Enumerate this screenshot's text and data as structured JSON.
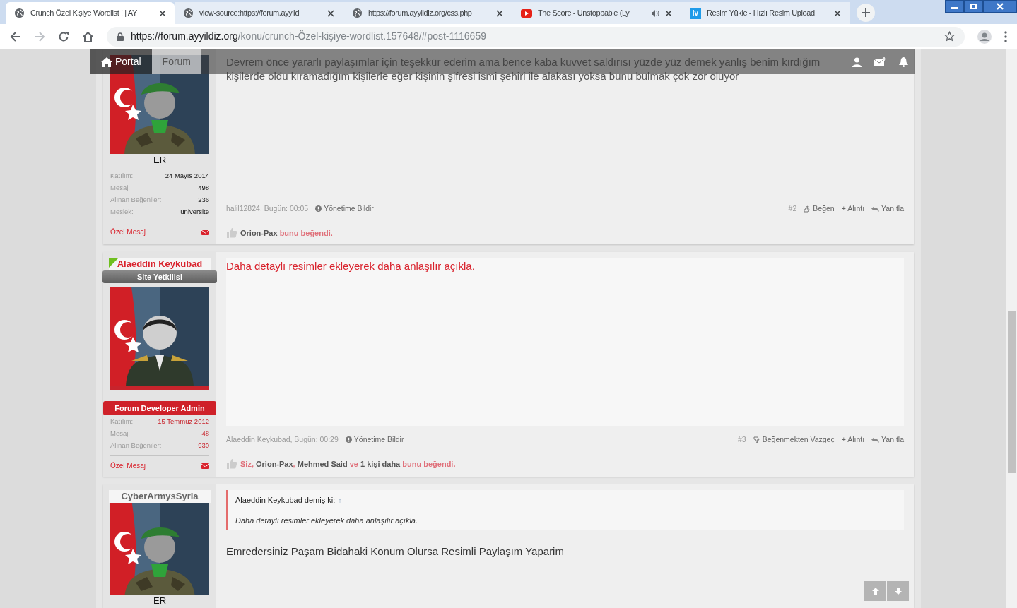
{
  "browser": {
    "tabs": [
      {
        "title": "Crunch Özel Kişiye Wordlist ! | AY",
        "kind": "globe",
        "selected": true,
        "audio": false
      },
      {
        "title": "view-source:https://forum.ayyildi",
        "kind": "globe",
        "selected": false,
        "audio": false
      },
      {
        "title": "https://forum.ayyildiz.org/css.php",
        "kind": "globe",
        "selected": false,
        "audio": false
      },
      {
        "title": "The Score - Unstoppable (Ly",
        "kind": "video",
        "selected": false,
        "audio": true
      },
      {
        "title": "Resim Yükle - Hızlı Resim Upload",
        "kind": "letters",
        "icon_text": "iv",
        "selected": false,
        "audio": false
      }
    ],
    "address": {
      "host": "https://forum.ayyildiz.org",
      "path": "/konu/crunch-Özel-kişiye-wordlist.157648/#post-1116659"
    }
  },
  "nav": {
    "items": [
      {
        "label": "Portal",
        "kind": "home",
        "selected": false
      },
      {
        "label": "Forum",
        "selected": true
      }
    ]
  },
  "posts": [
    {
      "user": {
        "staff": false,
        "title": "ER",
        "stats": [
          {
            "label": "Katılım:",
            "value": "24 Mayıs 2014"
          },
          {
            "label": "Mesaj:",
            "value": "498"
          },
          {
            "label": "Alınan Beğeniler:",
            "value": "236"
          },
          {
            "label": "Meslek:",
            "value": "üniversite"
          }
        ],
        "pm": "Özel Mesaj"
      },
      "text": "Devrem önce yararlı paylaşımlar için teşekkür ederim ama bence kaba kuvvet saldırısı yüzde yüz demek yanlış benim kırdığım kişilerde oldu kıramadığım kişilerle eğer kişinin şifresi ismi şehiri ile alakası yoksa bunu bulmak çok zor oluyor",
      "kind": "plain",
      "footer": {
        "author": "halil12824, Bugün: 00:05",
        "report": "Yönetime Bildir",
        "number": "#2",
        "liked": false,
        "like": "Beğen",
        "quote": "+ Alıntı",
        "reply": "Yanıtla"
      },
      "likes": "**Orion-Pax** bunu beğendi."
    },
    {
      "user": {
        "name": "Alaeddin Keykubad",
        "staff": true,
        "online": true,
        "banner": "Site Yetkilisi",
        "ribbon": "Forum Developer Admin",
        "stats": [
          {
            "label": "Katılım:",
            "value": "15 Temmuz 2012"
          },
          {
            "label": "Mesaj:",
            "value": "48"
          },
          {
            "label": "Alınan Beğeniler:",
            "value": "930"
          }
        ],
        "pm": "Özel Mesaj"
      },
      "text": "Daha detaylı resimler ekleyerek daha anlaşılır açıkla.",
      "kind": "highlight",
      "footer": {
        "author": "Alaeddin Keykubad, Bugün: 00:29",
        "report": "Yönetime Bildir",
        "number": "#3",
        "liked": true,
        "like": "Beğenmekten Vazgeç",
        "quote": "+ Alıntı",
        "reply": "Yanıtla"
      },
      "likes": "Siz, **Orion-Pax**, **Mehmed Said** ve **1 kişi daha** bunu beğendi."
    },
    {
      "user": {
        "name": "CyberArmysSyria",
        "staff": false,
        "online": false,
        "title": "ER"
      },
      "quote": {
        "author": "Alaeddin Keykubad demiş ki:",
        "arrow": "↑",
        "text": "Daha detaylı resimler ekleyerek daha anlaşılır açıkla."
      },
      "text": "Emredersiniz Paşam Bidahaki Konum Olursa Resimli Paylaşım Yaparim",
      "kind": "plain"
    }
  ]
}
